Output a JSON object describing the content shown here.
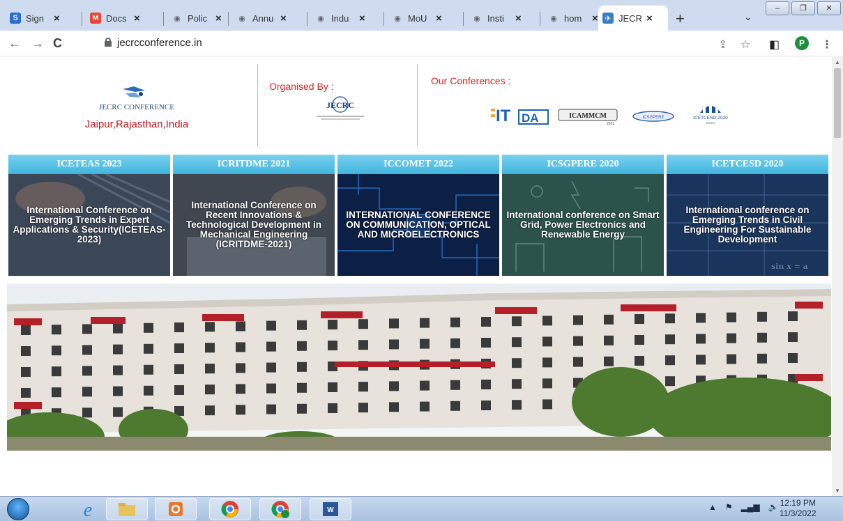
{
  "browser": {
    "tabs": [
      {
        "title": "Sign",
        "icon": "s-app-icon",
        "color": "#2d6bd6",
        "glyph": "S"
      },
      {
        "title": "Docs",
        "icon": "gmail-icon",
        "color": "#ea4335",
        "glyph": "M"
      },
      {
        "title": "Polic",
        "icon": "globe-icon",
        "color": "#5f6368",
        "glyph": "◉"
      },
      {
        "title": "Annu",
        "icon": "globe-icon",
        "color": "#5f6368",
        "glyph": "◉"
      },
      {
        "title": "Indu",
        "icon": "globe-icon",
        "color": "#5f6368",
        "glyph": "◉"
      },
      {
        "title": "MoU",
        "icon": "globe-icon",
        "color": "#5f6368",
        "glyph": "◉"
      },
      {
        "title": "Insti",
        "icon": "globe-icon",
        "color": "#5f6368",
        "glyph": "◉"
      },
      {
        "title": "hom",
        "icon": "globe-icon",
        "color": "#5f6368",
        "glyph": "◉"
      },
      {
        "title": "JECR",
        "icon": "jecrc-icon",
        "color": "#3a7fc4",
        "glyph": "✈"
      }
    ],
    "close_glyph": "×",
    "new_tab_glyph": "+",
    "url": "jecrcconference.in",
    "profile_initial": "P"
  },
  "page": {
    "brand": {
      "name": "JECRC CONFERENCE",
      "location": "Jaipur,Rajasthan,India"
    },
    "organised_by_label": "Organised By :",
    "org_logo_text": "JECRC",
    "conferences_label": "Our Conferences :",
    "conference_logos": [
      "ICITDA",
      "ICAMMCM",
      "ICSGPERE",
      "ICETCESD-2020"
    ],
    "cards": [
      {
        "title": "ICETEAS 2023",
        "body": "International Conference on Emerging Trends in Expert Applications & Security(ICETEAS-2023)",
        "bg": "#3d4a5c"
      },
      {
        "title": "ICRITDME 2021",
        "body": "International Conference on Recent Innovations & Technological Development in Mechanical Engineering (ICRITDME-2021)",
        "bg": "#3e4650"
      },
      {
        "title": "ICCOMET 2022",
        "body": "INTERNATIONAL CONFERENCE ON COMMUNICATION, OPTICAL AND MICROELECTRONICS",
        "bg": "#0f2a55"
      },
      {
        "title": "ICSGPERE 2020",
        "body": "International conference on Smart Grid, Power Electronics and Renewable Energy",
        "bg": "#2f5a52"
      },
      {
        "title": "ICETCESD 2020",
        "body": "International conference on Emerging Trends in Civil Engineering For Sustainable Development",
        "bg": "#1d3a63"
      }
    ]
  },
  "taskbar": {
    "apps": [
      "internet-explorer-icon",
      "file-explorer-icon",
      "outlook-icon",
      "chrome-icon",
      "chrome-profile-icon",
      "word-icon"
    ],
    "time": "12:19 PM",
    "date": "11/3/2022"
  }
}
